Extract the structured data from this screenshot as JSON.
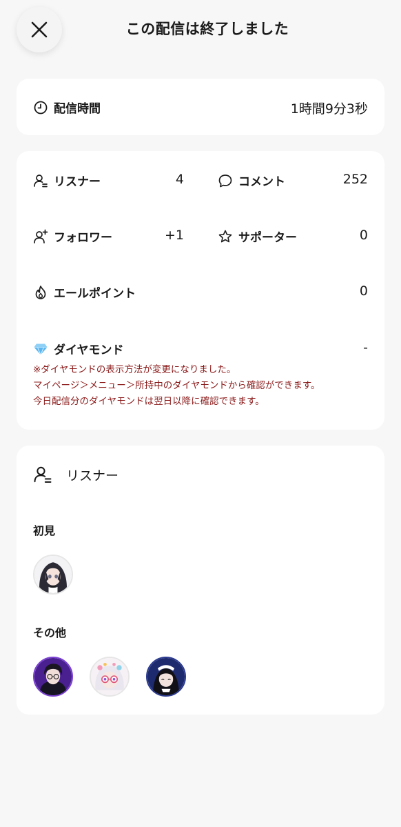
{
  "header": {
    "title": "この配信は終了しました",
    "close_icon": "close-icon"
  },
  "duration": {
    "label": "配信時間",
    "value": "1時間9分3秒",
    "icon": "clock-icon"
  },
  "stats": {
    "listeners": {
      "label": "リスナー",
      "value": "4",
      "icon": "person-icon"
    },
    "comments": {
      "label": "コメント",
      "value": "252",
      "icon": "comment-icon"
    },
    "followers": {
      "label": "フォロワー",
      "value": "+1",
      "icon": "person-add-icon"
    },
    "supporters": {
      "label": "サポーター",
      "value": "0",
      "icon": "star-icon"
    },
    "cheer_points": {
      "label": "エールポイント",
      "value": "0",
      "icon": "flame-icon"
    },
    "diamonds": {
      "label": "ダイヤモンド",
      "value": "-",
      "icon": "diamond-icon",
      "icon_color": "#5ab6f0"
    },
    "notice": {
      "line1": "※ダイヤモンドの表示方法が変更になりました。",
      "line2": "マイページ＞メニュー＞所持中のダイヤモンドから確認ができます。",
      "line3": "今日配信分のダイヤモンドは翌日以降に確認できます。",
      "color": "#8b1a1a"
    }
  },
  "listeners_section": {
    "title": "リスナー",
    "icon": "person-list-icon",
    "first_time": {
      "label": "初見",
      "avatars": [
        "avatar-dark-hair-girl"
      ]
    },
    "others": {
      "label": "その他",
      "avatars": [
        "avatar-glasses-purple",
        "avatar-pastel-glasses",
        "avatar-maid-navy"
      ]
    }
  }
}
